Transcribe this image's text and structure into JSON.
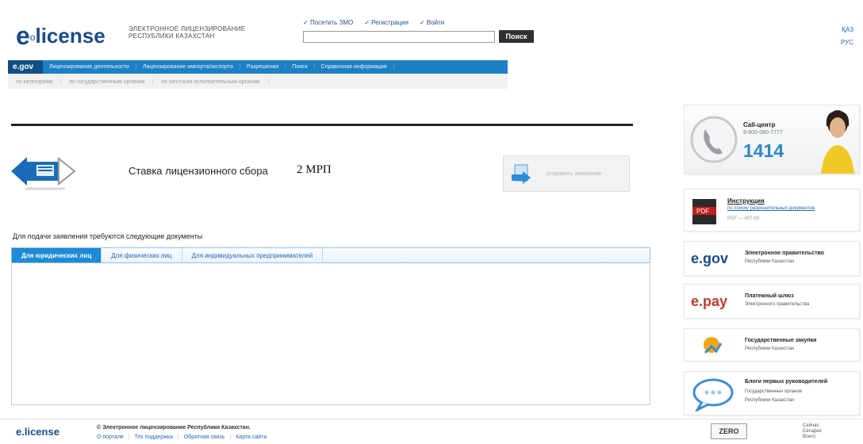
{
  "header": {
    "logo_e": "e",
    "logo_sub": "o",
    "logo_word": "license",
    "portal_name_line1": "ЭЛЕКТРОННОЕ ЛИЦЕНЗИРОВАНИЕ",
    "portal_name_line2": "РЕСПУБЛИКИ КАЗАХСТАН",
    "top_links": [
      "Посетить ЗМО",
      "Регистрация",
      "Войти"
    ],
    "search_button": "Поиск",
    "languages": [
      "ҚАЗ",
      "РУС"
    ]
  },
  "nav": {
    "egov_label": "e.gov",
    "items": [
      "Лицензирование деятельности",
      "Лицензирование импорта/экспорта",
      "Разрешения",
      "Поиск",
      "Справочная информация"
    ],
    "subitems": [
      "по категориям",
      "по государственным органам",
      "по местным исполнительным органам"
    ]
  },
  "main": {
    "rate_label": "Ставка лицензионного сбора",
    "rate_value": "2 МРП",
    "submit_label": "отправить заявление",
    "docs_title": "Для подачи заявления требуются следующие документы",
    "tabs": [
      "Для юридических лиц",
      "Для физических лиц",
      "Для индивидуальных предпринимателей"
    ],
    "active_tab": 0
  },
  "sidebar": {
    "callcenter": {
      "title": "Call-центр",
      "phone": "8-800-080-7777",
      "short": "1414"
    },
    "instruction": {
      "title": "Инструкция",
      "link": "по поиску разрешительных документов",
      "meta": "PDF — 497 Кб"
    },
    "egov": {
      "brand": "e.gov",
      "t1": "Электронное правительство",
      "t2": "Республики Казахстан"
    },
    "epay": {
      "brand": "e.pay",
      "t1": "Платежный шлюз",
      "t2": "Электронного правительства"
    },
    "goszakupki": {
      "t1": "Государственные закупки",
      "t2": "Республики Казахстан"
    },
    "blogs": {
      "t1": "Блоги первых руководителей",
      "t2": "Государственных органов",
      "t3": "Республики Казахстан"
    }
  },
  "footer": {
    "logo": "e.license",
    "copyright": "© Электронное лицензирование Республики Казахстан.",
    "links": [
      "О портале",
      "Тех поддержка",
      "Обратная связь",
      "Карта сайта"
    ],
    "zero_label": "ZERO",
    "counters": [
      "Сейчас:",
      "Сегодня:",
      "Всего:"
    ]
  },
  "colors": {
    "brand_blue": "#1a4c8c",
    "nav_blue": "#1d7fc4",
    "link_blue": "#2266bb"
  }
}
